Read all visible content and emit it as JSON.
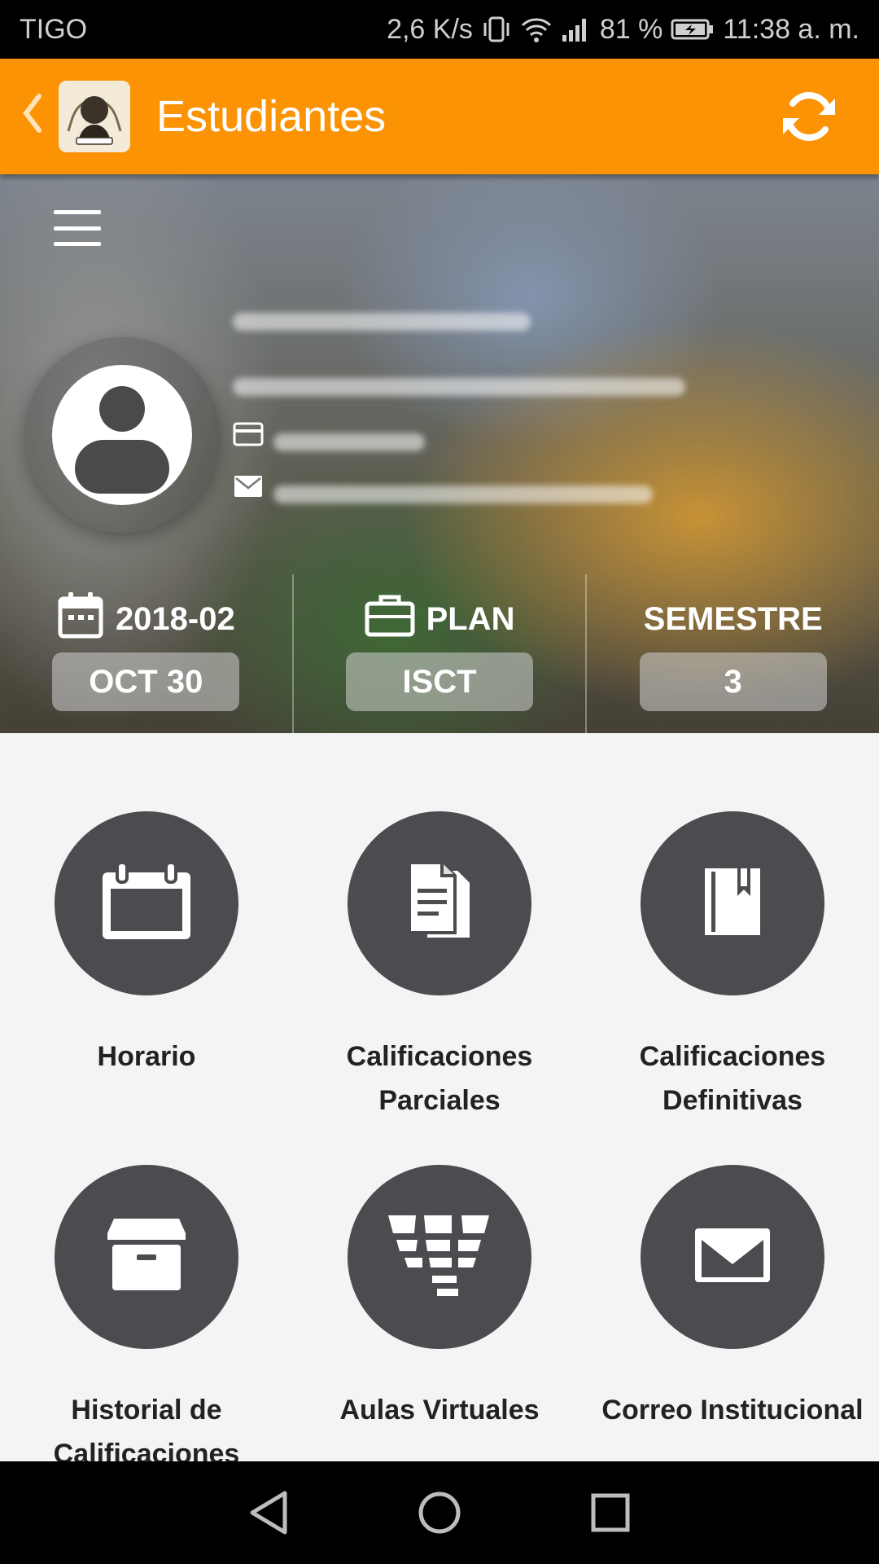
{
  "status_bar": {
    "carrier": "TIGO",
    "speed": "2,6 K/s",
    "battery": "81 %",
    "time": "11:38 a. m."
  },
  "app_bar": {
    "title": "Estudiantes"
  },
  "stats": [
    {
      "icon": "calendar-icon",
      "heading": "2018-02",
      "value": "OCT 30"
    },
    {
      "icon": "briefcase-icon",
      "heading": "PLAN",
      "value": "ISCT"
    },
    {
      "icon": "",
      "heading": "SEMESTRE",
      "value": "3"
    }
  ],
  "menu_items": [
    {
      "icon": "calendar-icon",
      "label": "Horario"
    },
    {
      "icon": "documents-icon",
      "label": "Calificaciones\nParciales"
    },
    {
      "icon": "book-icon",
      "label": "Calificaciones\nDefinitivas"
    },
    {
      "icon": "archive-box-icon",
      "label": "Historial de\nCalificaciones"
    },
    {
      "icon": "virtual-classroom-icon",
      "label": "Aulas Virtuales"
    },
    {
      "icon": "mail-icon",
      "label": "Correo Institucional"
    }
  ],
  "colors": {
    "app_bar": "#fb9305",
    "tile_circle": "#4a4c4f",
    "background": "#f4f4f4"
  }
}
